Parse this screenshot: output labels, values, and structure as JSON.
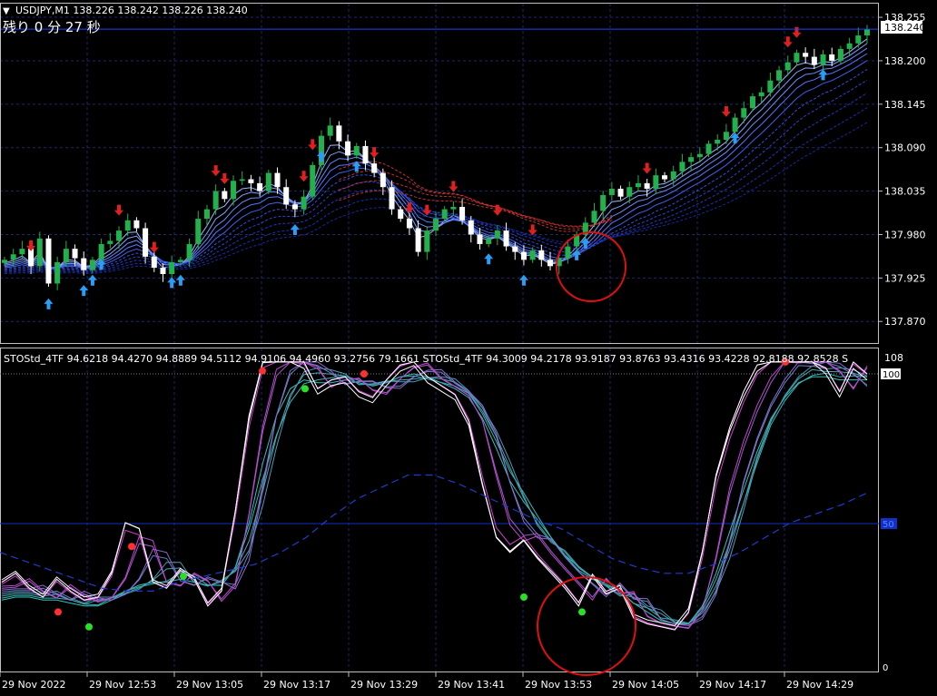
{
  "header": {
    "symbol_line": "USDJPY,M1  138.226 138.242 138.226 138.240",
    "countdown": "残り 0 分 27 秒"
  },
  "colors": {
    "background": "#000000",
    "grid": "#1a2a6b",
    "axis": "#c0c0c0",
    "bull_candle": "#22b14c",
    "bear_candle": "#ffffff",
    "price_line": "#2040ff",
    "up_arrow": "#2a9df4",
    "down_arrow": "#e02020",
    "sto_magenta": "#d43fd4",
    "sto_teal": "#2ec4b6",
    "sto_white": "#ffffff",
    "signal_green": "#28e028",
    "signal_red": "#ff3030",
    "circle": "#e01010"
  },
  "chart_data": [
    {
      "type": "candlestick",
      "title": "USDJPY,M1",
      "current_price": "138.240",
      "y_ticks": [
        "138.255",
        "138.200",
        "138.145",
        "138.090",
        "138.035",
        "137.980",
        "137.925",
        "137.870"
      ],
      "ylim": [
        137.845,
        138.27
      ],
      "close": [
        137.948,
        137.955,
        137.962,
        137.94,
        137.975,
        137.918,
        137.945,
        137.962,
        137.95,
        137.935,
        137.948,
        137.968,
        137.972,
        137.985,
        137.998,
        137.988,
        137.952,
        137.938,
        137.93,
        137.945,
        137.948,
        137.968,
        138.0,
        138.012,
        138.035,
        138.025,
        138.048,
        138.05,
        138.045,
        138.035,
        138.058,
        138.04,
        138.018,
        138.012,
        138.028,
        138.068,
        138.105,
        138.118,
        138.098,
        138.08,
        138.092,
        138.07,
        138.058,
        138.04,
        138.012,
        138.0,
        137.988,
        137.958,
        137.985,
        138.0,
        138.012,
        138.015,
        137.998,
        137.98,
        137.968,
        137.975,
        137.985,
        137.965,
        137.958,
        137.948,
        137.96,
        137.948,
        137.94,
        137.95,
        137.965,
        137.98,
        137.995,
        138.01,
        138.03,
        138.038,
        138.028,
        138.04,
        138.045,
        138.038,
        138.055,
        138.05,
        138.06,
        138.072,
        138.078,
        138.082,
        138.095,
        138.1,
        138.11,
        138.128,
        138.14,
        138.155,
        138.16,
        138.175,
        138.188,
        138.198,
        138.21,
        138.205,
        138.195,
        138.208,
        138.2,
        138.215,
        138.222,
        138.232,
        138.24
      ],
      "up_arrow_bars": [
        5,
        9,
        10,
        11,
        19,
        20,
        33,
        36,
        40,
        55,
        59,
        65,
        66,
        83,
        93
      ],
      "down_arrow_bars": [
        3,
        13,
        17,
        24,
        25,
        34,
        35,
        42,
        46,
        48,
        51,
        56,
        60,
        73,
        82,
        89,
        90
      ]
    },
    {
      "type": "line",
      "title": "STOStd_4TF",
      "header_text": "STOStd_4TF 94.6218 94.4270 94.8889 94.5112 94.9106 94.4960 93.2756 79.1661  STOStd_4TF 94.3009 94.2178 93.9187 93.8763 93.4316 93.4228 92.8188 92.8528  S",
      "y_labels": {
        "top": "108",
        "max": "100",
        "mid": "50",
        "bottom": "0"
      },
      "ylim": [
        0,
        108
      ],
      "series_fast": [
        30,
        33,
        28,
        25,
        31,
        27,
        24,
        25,
        33,
        50,
        48,
        30,
        28,
        34,
        31,
        22,
        27,
        54,
        86,
        106,
        112,
        110,
        104,
        95,
        98,
        99,
        94,
        92,
        98,
        103,
        105,
        99,
        96,
        93,
        84,
        63,
        45,
        40,
        44,
        38,
        33,
        28,
        22,
        32,
        26,
        28,
        18,
        16,
        15,
        14,
        20,
        40,
        66,
        82,
        94,
        103,
        110,
        107,
        110,
        108,
        102,
        94,
        104,
        100
      ],
      "series_slow": [
        24,
        25,
        25,
        24,
        24,
        23,
        22,
        22,
        24,
        27,
        29,
        30,
        30,
        31,
        30,
        29,
        29,
        35,
        50,
        70,
        86,
        95,
        98,
        97,
        97,
        98,
        97,
        96,
        97,
        99,
        100,
        99,
        97,
        95,
        92,
        85,
        75,
        64,
        57,
        51,
        45,
        39,
        34,
        31,
        29,
        27,
        23,
        20,
        17,
        16,
        16,
        22,
        33,
        47,
        61,
        74,
        85,
        92,
        97,
        99,
        99,
        98,
        98,
        98
      ],
      "series_baseline": [
        40,
        37,
        34,
        31,
        28,
        27,
        27,
        30,
        32,
        34,
        36,
        40,
        45,
        52,
        58,
        62,
        66,
        66,
        63,
        59,
        55,
        51,
        48,
        43,
        38,
        35,
        33,
        33,
        36,
        40,
        45,
        50,
        53,
        56,
        60
      ],
      "green_dots": [
        [
          98,
          15
        ],
        [
          202,
          32
        ],
        [
          336,
          95
        ],
        [
          577,
          25
        ],
        [
          641,
          20
        ]
      ],
      "red_dots": [
        [
          64,
          20
        ],
        [
          145,
          42
        ],
        [
          289,
          101
        ],
        [
          401,
          100
        ],
        [
          865,
          104
        ]
      ],
      "x_ticks": [
        "29 Nov 2022",
        "29 Nov 12:53",
        "29 Nov 13:05",
        "29 Nov 13:17",
        "29 Nov 13:29",
        "29 Nov 13:41",
        "29 Nov 13:53",
        "29 Nov 14:05",
        "29 Nov 14:17",
        "29 Nov 14:29"
      ]
    }
  ]
}
